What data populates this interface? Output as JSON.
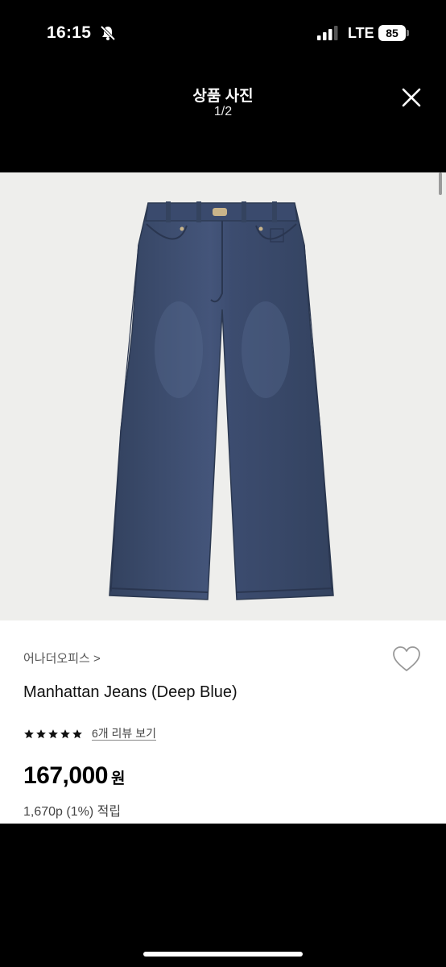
{
  "status_bar": {
    "time": "16:15",
    "network": "LTE",
    "battery": "85"
  },
  "header": {
    "title": "상품 사진",
    "counter": "1/2"
  },
  "product": {
    "brand": "어나더오피스 >",
    "name": "Manhattan Jeans (Deep Blue)",
    "rating_stars": 5,
    "review_link": "6개 리뷰 보기",
    "price": "167,000",
    "currency": "원",
    "points": "1,670p (1%) 적립"
  },
  "colors": {
    "background": "#000000",
    "photo_bg": "#eeeeec",
    "denim": "#3a4a6c"
  },
  "icons": [
    "bell-off-icon",
    "signal-icon",
    "close-icon",
    "heart-icon",
    "star-icon"
  ]
}
